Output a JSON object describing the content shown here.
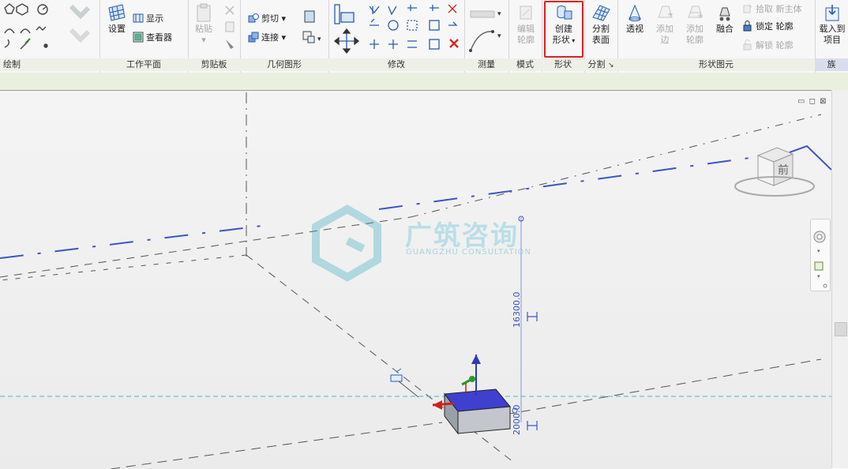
{
  "ribbon": {
    "panels": {
      "draw": "绘制",
      "work_plane": "工作平面",
      "clipboard": "剪贴板",
      "geometry": "几何图形",
      "modify": "修改",
      "measure": "测量",
      "mode": "模式",
      "shape": "形状",
      "divide": "分割",
      "form_element": "形状图元",
      "extra": "族"
    },
    "work_plane": {
      "set": "设置",
      "show": "显示",
      "viewer": "查看器"
    },
    "clipboard": {
      "paste_line1": "粘贴",
      "paste_arrow": "▾"
    },
    "geometry": {
      "cut": "剪切",
      "join": "连接"
    },
    "mode": {
      "edit_profile_line1": "编辑",
      "edit_profile_line2": "轮廓"
    },
    "shape": {
      "create_form_line1": "创建",
      "create_form_line2": "形状"
    },
    "divide": {
      "divide_surface_line1": "分割",
      "divide_surface_line2": "表面"
    },
    "form_element": {
      "xray": "透视",
      "add_edge_line1": "添加",
      "add_edge_line2": "边",
      "add_profile_line1": "添加",
      "add_profile_line2": "轮廓",
      "dissolve": "融合",
      "pick_new_host": "拾取 新主体",
      "lock_profiles": "锁定 轮廓",
      "unlock_profiles": "解锁 轮廓"
    },
    "load": {
      "label_line1": "载入到",
      "label_line2": "项目"
    }
  },
  "viewport": {
    "watermark_title": "广筑咨询",
    "watermark_sub": "GUANGZHU CONSULTATION",
    "viewcube_face": "前",
    "dim_height": "16300.0",
    "dim_small": "2000.0",
    "window_controls": "▭ ◻ ⊠"
  },
  "colors": {
    "accent_blue": "#3b55c8",
    "selection_red": "#e02020",
    "cube_top": "#3f3fd0"
  }
}
